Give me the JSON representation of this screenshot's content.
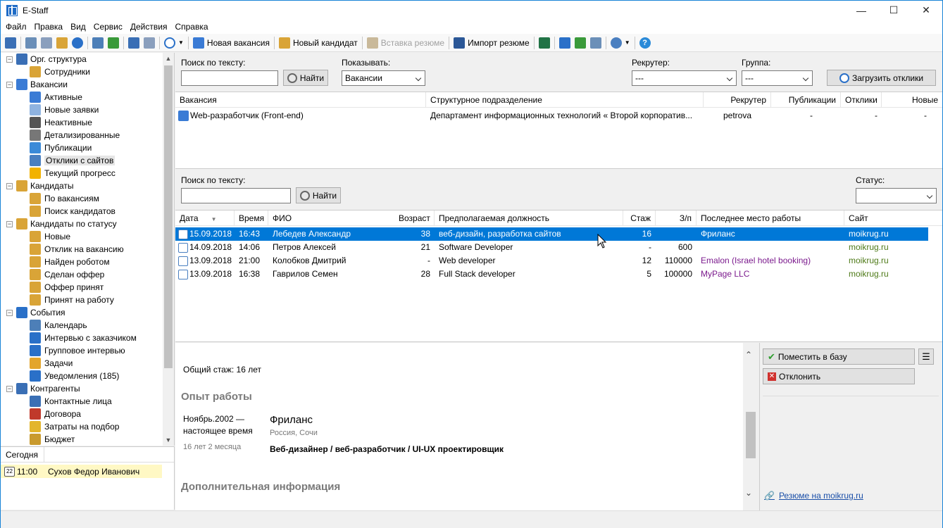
{
  "window": {
    "title": "E-Staff"
  },
  "menu": [
    "Файл",
    "Правка",
    "Вид",
    "Сервис",
    "Действия",
    "Справка"
  ],
  "toolbar": {
    "new_vacancy": "Новая вакансия",
    "new_candidate": "Новый кандидат",
    "paste_resume": "Вставка резюме",
    "import_resume": "Импорт резюме"
  },
  "tree": [
    {
      "label": "Орг. структура",
      "level": 0,
      "exp": "−",
      "icon": "org-structure-icon",
      "color": "#3a6fb5"
    },
    {
      "label": "Сотрудники",
      "level": 1,
      "icon": "employee-icon",
      "color": "#d9a437"
    },
    {
      "label": "Вакансии",
      "level": 0,
      "exp": "−",
      "icon": "vacancies-icon",
      "color": "#3a7bd5"
    },
    {
      "label": "Активные",
      "level": 1,
      "icon": "active-vacancy-icon",
      "color": "#3a7bd5"
    },
    {
      "label": "Новые заявки",
      "level": 1,
      "icon": "new-requests-icon",
      "color": "#8fb3e0"
    },
    {
      "label": "Неактивные",
      "level": 1,
      "icon": "inactive-vacancy-icon",
      "color": "#555"
    },
    {
      "label": "Детализированные",
      "level": 1,
      "icon": "detailed-icon",
      "color": "#777"
    },
    {
      "label": "Публикации",
      "level": 1,
      "icon": "publications-icon",
      "color": "#3b8ad8"
    },
    {
      "label": "Отклики с сайтов",
      "level": 1,
      "icon": "site-responses-icon",
      "color": "#4a7fc0",
      "selected": true
    },
    {
      "label": "Текущий прогресс",
      "level": 1,
      "icon": "progress-icon",
      "color": "#f2b200"
    },
    {
      "label": "Кандидаты",
      "level": 0,
      "exp": "−",
      "icon": "candidates-icon",
      "color": "#d9a437"
    },
    {
      "label": "По вакансиям",
      "level": 1,
      "icon": "by-vacancy-icon",
      "color": "#d9a437"
    },
    {
      "label": "Поиск кандидатов",
      "level": 1,
      "icon": "search-candidates-icon",
      "color": "#d9a437"
    },
    {
      "label": "Кандидаты по статусу",
      "level": 0,
      "exp": "−",
      "icon": "candidates-status-icon",
      "color": "#d9a437"
    },
    {
      "label": "Новые",
      "level": 1,
      "icon": "new-candidate-icon",
      "color": "#d9a437"
    },
    {
      "label": "Отклик на вакансию",
      "level": 1,
      "icon": "response-icon",
      "color": "#d9a437"
    },
    {
      "label": "Найден роботом",
      "level": 1,
      "icon": "robot-icon",
      "color": "#d9a437"
    },
    {
      "label": "Сделан оффер",
      "level": 1,
      "icon": "offer-made-icon",
      "color": "#d9a437"
    },
    {
      "label": "Оффер принят",
      "level": 1,
      "icon": "offer-accepted-icon",
      "color": "#d9a437"
    },
    {
      "label": "Принят на работу",
      "level": 1,
      "icon": "hired-icon",
      "color": "#d9a437"
    },
    {
      "label": "События",
      "level": 0,
      "exp": "−",
      "icon": "events-icon",
      "color": "#2a70c8"
    },
    {
      "label": "Календарь",
      "level": 1,
      "icon": "calendar-icon",
      "color": "#4d7fb8"
    },
    {
      "label": "Интервью с заказчиком",
      "level": 1,
      "icon": "client-interview-icon",
      "color": "#2a70c8"
    },
    {
      "label": "Групповое интервью",
      "level": 1,
      "icon": "group-interview-icon",
      "color": "#2a70c8"
    },
    {
      "label": "Задачи",
      "level": 1,
      "icon": "tasks-icon",
      "color": "#e3a52c"
    },
    {
      "label": "Уведомления  (185)",
      "level": 1,
      "icon": "notifications-icon",
      "color": "#2a70c8"
    },
    {
      "label": "Контрагенты",
      "level": 0,
      "exp": "−",
      "icon": "contractors-icon",
      "color": "#3a6fb5"
    },
    {
      "label": "Контактные лица",
      "level": 1,
      "icon": "contacts-icon",
      "color": "#3a6fb5"
    },
    {
      "label": "Договора",
      "level": 1,
      "icon": "contracts-icon",
      "color": "#c0392b"
    },
    {
      "label": "Затраты на подбор",
      "level": 1,
      "icon": "costs-icon",
      "color": "#e3b52c"
    },
    {
      "label": "Бюджет",
      "level": 1,
      "icon": "budget-icon",
      "color": "#c99a2e"
    }
  ],
  "today": {
    "header": "Сегодня",
    "time": "11:00",
    "person": "Сухов Федор Иванович"
  },
  "filters": {
    "search_label": "Поиск по тексту:",
    "find_btn": "Найти",
    "show_label": "Показывать:",
    "show_value": "Вакансии",
    "recruiter_label": "Рекрутер:",
    "recruiter_value": "---",
    "group_label": "Группа:",
    "group_value": "---",
    "load_btn": "Загрузить отклики"
  },
  "grid1": {
    "headers": [
      "Вакансия",
      "Структурное подразделение",
      "Рекрутер",
      "Публикации",
      "Отклики",
      "Новые"
    ],
    "rows": [
      {
        "vacancy": "Web-разработчик (Front-end)",
        "dept": "Департамент информационных технологий  «  Второй корпоратив...",
        "recruiter": "petrova",
        "pubs": "-",
        "responses": "-",
        "new": "-"
      }
    ]
  },
  "filters2": {
    "search_label": "Поиск по тексту:",
    "find_btn": "Найти",
    "status_label": "Статус:"
  },
  "grid2": {
    "headers": [
      "Дата",
      "Время",
      "ФИО",
      "Возраст",
      "Предполагаемая должность",
      "Стаж",
      "З/п",
      "Последнее место работы",
      "Сайт"
    ],
    "rows": [
      {
        "date": "15.09.2018",
        "time": "16:43",
        "name": "Лебедев Александр",
        "age": "38",
        "position": "веб-дизайн, разработка сайтов",
        "exp": "16",
        "salary": "",
        "last": "Фриланс",
        "site": "moikrug.ru"
      },
      {
        "date": "14.09.2018",
        "time": "14:06",
        "name": "Петров Алексей",
        "age": "21",
        "position": "Software Developer",
        "exp": "-",
        "salary": "600",
        "last": "",
        "site": "moikrug.ru"
      },
      {
        "date": "13.09.2018",
        "time": "21:00",
        "name": "Колобков Дмитрий",
        "age": "-",
        "position": "Web developer",
        "exp": "12",
        "salary": "110000",
        "last": "Emalon (Israel hotel booking)",
        "site": "moikrug.ru"
      },
      {
        "date": "13.09.2018",
        "time": "16:38",
        "name": "Гаврилов Семен",
        "age": "28",
        "position": "Full Stack developer",
        "exp": "5",
        "salary": "100000",
        "last": "MyPage LLC",
        "site": "moikrug.ru"
      }
    ]
  },
  "detail": {
    "total_exp": "Общий стаж: 16 лет",
    "work_title": "Опыт работы",
    "period": "Ноябрь.2002 —",
    "period2": "настоящее время",
    "duration": "16 лет 2 месяца",
    "company": "Фриланс",
    "location": "Россия, Сочи",
    "role": "Веб-дизайнер / веб-разработчик / UI-UX проектировщик",
    "more_title": "Дополнительная информация"
  },
  "actions": {
    "place_btn": "Поместить в базу",
    "reject_btn": "Отклонить",
    "resume_link": "Резюме на moikrug.ru"
  }
}
